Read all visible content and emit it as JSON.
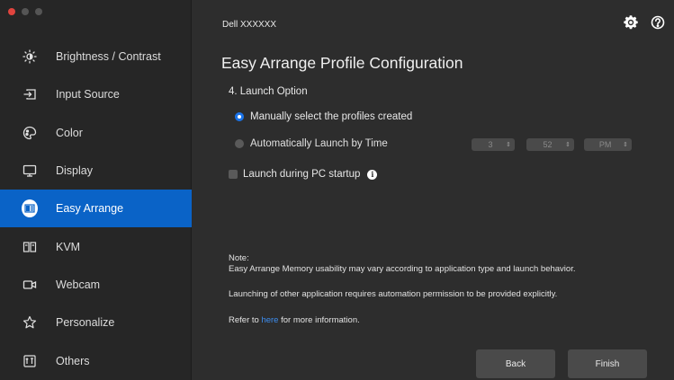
{
  "window": {
    "title": "Dell XXXXXX"
  },
  "sidebar": {
    "items": [
      {
        "label": "Brightness / Contrast",
        "icon": "brightness-icon"
      },
      {
        "label": "Input Source",
        "icon": "input-source-icon"
      },
      {
        "label": "Color",
        "icon": "color-icon"
      },
      {
        "label": "Display",
        "icon": "display-icon"
      },
      {
        "label": "Easy Arrange",
        "icon": "easy-arrange-icon",
        "active": true
      },
      {
        "label": "KVM",
        "icon": "kvm-icon"
      },
      {
        "label": "Webcam",
        "icon": "webcam-icon"
      },
      {
        "label": "Personalize",
        "icon": "star-icon"
      },
      {
        "label": "Others",
        "icon": "others-icon"
      }
    ]
  },
  "main": {
    "title": "Easy Arrange Profile Configuration",
    "section": "4. Launch Option",
    "options": {
      "manual": "Manually select the profiles created",
      "auto": "Automatically Launch by Time",
      "selected": "manual"
    },
    "time": {
      "hour": "3",
      "minute": "52",
      "ampm": "PM"
    },
    "startup": {
      "label": "Launch during PC startup",
      "checked": false
    },
    "note": {
      "heading": "Note:",
      "line1": "Easy Arrange Memory usability may vary according to application type and launch behavior.",
      "line2": "Launching of other application requires automation permission to be provided explicitly.",
      "refer_prefix": "Refer to",
      "refer_link": "here",
      "refer_suffix": "for more information."
    },
    "buttons": {
      "back": "Back",
      "finish": "Finish"
    }
  },
  "colors": {
    "accent": "#0a63c7",
    "link": "#3d8ef0",
    "background": "#2d2d2d",
    "sidebar": "#262626"
  }
}
